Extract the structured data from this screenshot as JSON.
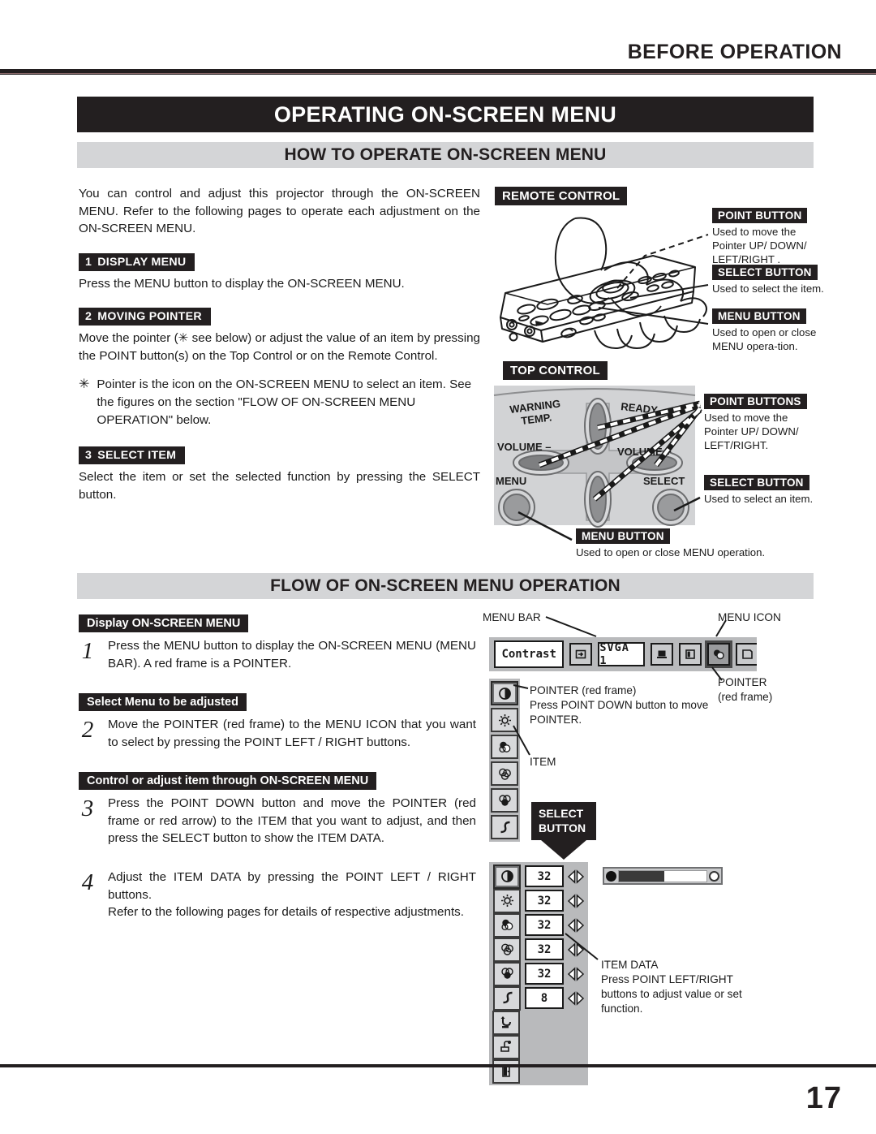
{
  "header": {
    "running_head": "BEFORE OPERATION"
  },
  "title_bar": {
    "title": "OPERATING ON-SCREEN MENU"
  },
  "section_how": {
    "heading": "HOW TO OPERATE ON-SCREEN MENU",
    "intro": "You can control and adjust this projector through the ON-SCREEN MENU.  Refer to the following pages to operate each adjustment on the ON-SCREEN MENU.",
    "steps": [
      {
        "num": "1",
        "tag": "DISPLAY MENU",
        "body": "Press the MENU button to display the ON-SCREEN MENU."
      },
      {
        "num": "2",
        "tag": "MOVING POINTER",
        "body": "Move the pointer (✳ see below) or adjust the value of an item by pressing the POINT button(s) on the Top Control or on the Remote Control."
      },
      {
        "num": "3",
        "tag": "SELECT ITEM",
        "body": "Select the item or set the selected function by pressing the SELECT button."
      }
    ],
    "note": {
      "star": "✳",
      "text": "Pointer is the icon on the ON-SCREEN MENU to select an item. See the figures on the section \"FLOW OF ON-SCREEN MENU OPERATION\" below."
    }
  },
  "fig_remote": {
    "heading": "REMOTE CONTROL",
    "callouts": [
      {
        "label": "POINT BUTTON",
        "desc": "Used to move the Pointer UP/ DOWN/ LEFT/RIGHT ."
      },
      {
        "label": "SELECT BUTTON",
        "desc": "Used to select the item."
      },
      {
        "label": "MENU BUTTON",
        "desc": "Used to open or close MENU opera-tion."
      }
    ]
  },
  "fig_top_control": {
    "heading": "TOP CONTROL",
    "panel_labels": {
      "warning": "WARNING",
      "temp": "TEMP.",
      "ready": "READY",
      "volume_minus": "VOLUME –",
      "volume_plus": "VOLUME +",
      "menu": "MENU",
      "select": "SELECT"
    },
    "callouts": [
      {
        "label": "POINT BUTTONS",
        "desc": "Used to move the Pointer UP/ DOWN/ LEFT/RIGHT."
      },
      {
        "label": "SELECT BUTTON",
        "desc": "Used to select an item."
      },
      {
        "label": "MENU BUTTON",
        "desc": "Used to open or close MENU operation."
      }
    ]
  },
  "section_flow": {
    "heading": "FLOW OF ON-SCREEN MENU OPERATION",
    "groups": [
      {
        "tag": "Display ON-SCREEN MENU",
        "steps": [
          {
            "num": "1",
            "text": "Press the MENU button to display the ON-SCREEN MENU (MENU BAR).  A red frame is a POINTER."
          }
        ]
      },
      {
        "tag": "Select Menu to be adjusted",
        "steps": [
          {
            "num": "2",
            "text": "Move the POINTER (red frame) to the MENU ICON that you want to select by pressing the POINT LEFT / RIGHT buttons."
          }
        ]
      },
      {
        "tag": "Control or adjust item through ON-SCREEN MENU",
        "steps": [
          {
            "num": "3",
            "text": "Press the POINT DOWN button and move the POINTER (red frame or red arrow) to the ITEM that you want to adjust, and then press the SELECT button to show the ITEM DATA."
          },
          {
            "num": "4",
            "text": "Adjust the ITEM DATA by pressing the POINT LEFT / RIGHT buttons.\nRefer to the following pages for details of respective adjustments."
          }
        ]
      }
    ]
  },
  "fig_menu": {
    "label_menu_bar": "MENU BAR",
    "label_menu_icon": "MENU ICON",
    "label_pointer_right": "POINTER\n(red frame)",
    "menu_bar": {
      "title": "Contrast",
      "system": "SVGA 1",
      "icons": [
        {
          "name": "input-icon",
          "selected": false
        },
        {
          "name": "computer-icon",
          "selected": false
        },
        {
          "name": "screen-icon",
          "selected": false
        },
        {
          "name": "image-icon",
          "selected": true
        },
        {
          "name": "pc-adjust-icon",
          "selected": false
        }
      ]
    },
    "pointer_note": {
      "label": "POINTER (red frame)",
      "text": "Press POINT DOWN button to move POINTER."
    },
    "item_label": "ITEM",
    "select_button": {
      "line1": "SELECT",
      "line2": "BUTTON"
    },
    "item_rows": [
      {
        "icon": "contrast-icon",
        "value": "32"
      },
      {
        "icon": "brightness-icon",
        "value": "32"
      },
      {
        "icon": "color-icon",
        "value": "32"
      },
      {
        "icon": "tint-icon",
        "value": "32"
      },
      {
        "icon": "white-balance-icon",
        "value": "32"
      },
      {
        "icon": "gamma-icon",
        "value": "8"
      }
    ],
    "extra_icons": [
      {
        "icon": "reset-icon"
      },
      {
        "icon": "store-icon"
      },
      {
        "icon": "quit-icon"
      }
    ],
    "item_data_note": {
      "label": "ITEM DATA",
      "text": "Press POINT LEFT/RIGHT buttons to adjust value or set function."
    },
    "menu_icons_column": [
      {
        "icon": "contrast-icon",
        "selected": true
      },
      {
        "icon": "brightness-icon",
        "selected": false
      },
      {
        "icon": "color-icon",
        "selected": false
      },
      {
        "icon": "tint-icon",
        "selected": false
      },
      {
        "icon": "white-balance-icon",
        "selected": false
      },
      {
        "icon": "gamma-icon",
        "selected": false
      }
    ]
  },
  "footer": {
    "page_number": "17"
  },
  "colors": {
    "ink": "#231f20",
    "bar_gray": "#d4d5d7",
    "panel_gray": "#b9babc"
  }
}
